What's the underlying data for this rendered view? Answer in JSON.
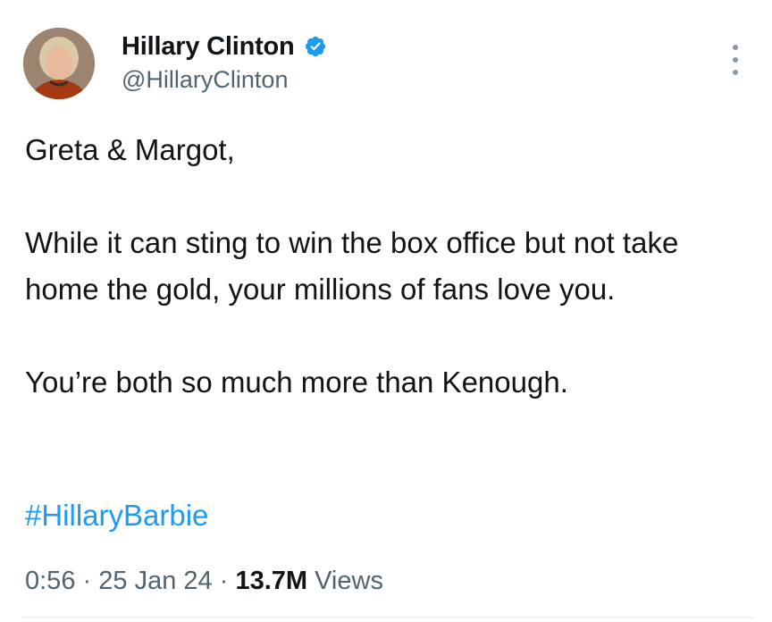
{
  "author": {
    "name": "Hillary Clinton",
    "handle": "@HillaryClinton",
    "verified_color": "#1d9bf0"
  },
  "tweet": {
    "paragraphs": [
      "Greta & Margot,",
      "While it can sting to win the box office but not take home the gold, your millions of fans love you.",
      "You’re both so much more than Kenough."
    ],
    "hashtag": "#HillaryBarbie",
    "time": "0:56",
    "separator": "·",
    "date": "25 Jan 24",
    "views_count": "13.7M",
    "views_label": "Views"
  },
  "icons": {
    "verified": "verified-badge-icon",
    "more": "more-options-icon"
  },
  "colors": {
    "text": "#0f1419",
    "secondary": "#536471",
    "link": "#1d9bf0"
  }
}
